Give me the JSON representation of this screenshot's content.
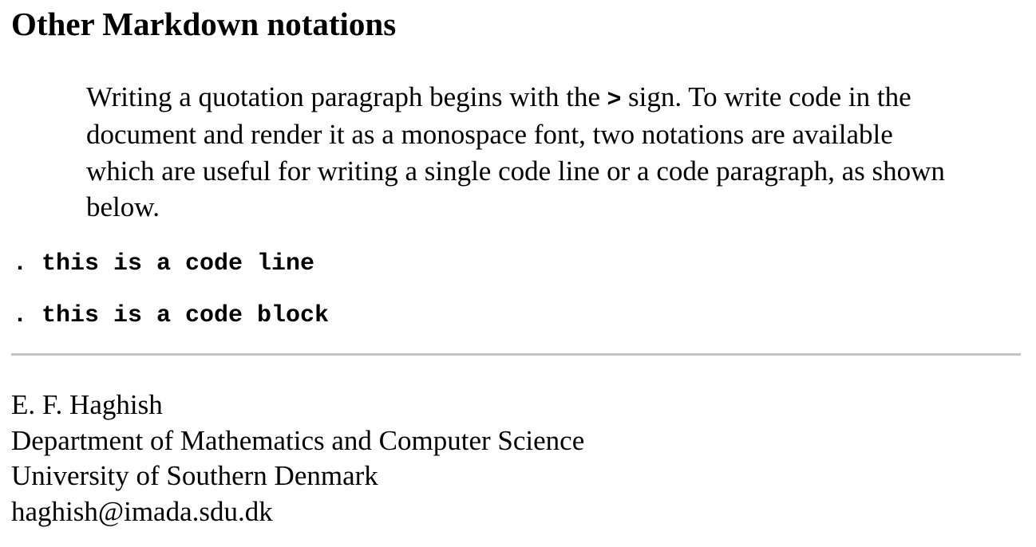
{
  "heading": "Other Markdown notations",
  "quote": {
    "text_before": "Writing a quotation paragraph begins with the ",
    "symbol": ">",
    "text_after": " sign. To write code in the document and render it as a monospace font, two notations are available which are useful for writing a single code line or a code paragraph, as shown below."
  },
  "code_lines": [
    ". this is a code line",
    ". this is a code block"
  ],
  "author": {
    "name": "E. F. Haghish",
    "department": "Department of Mathematics and Computer Science",
    "university": "University of Southern Denmark",
    "email": "haghish@imada.sdu.dk"
  }
}
